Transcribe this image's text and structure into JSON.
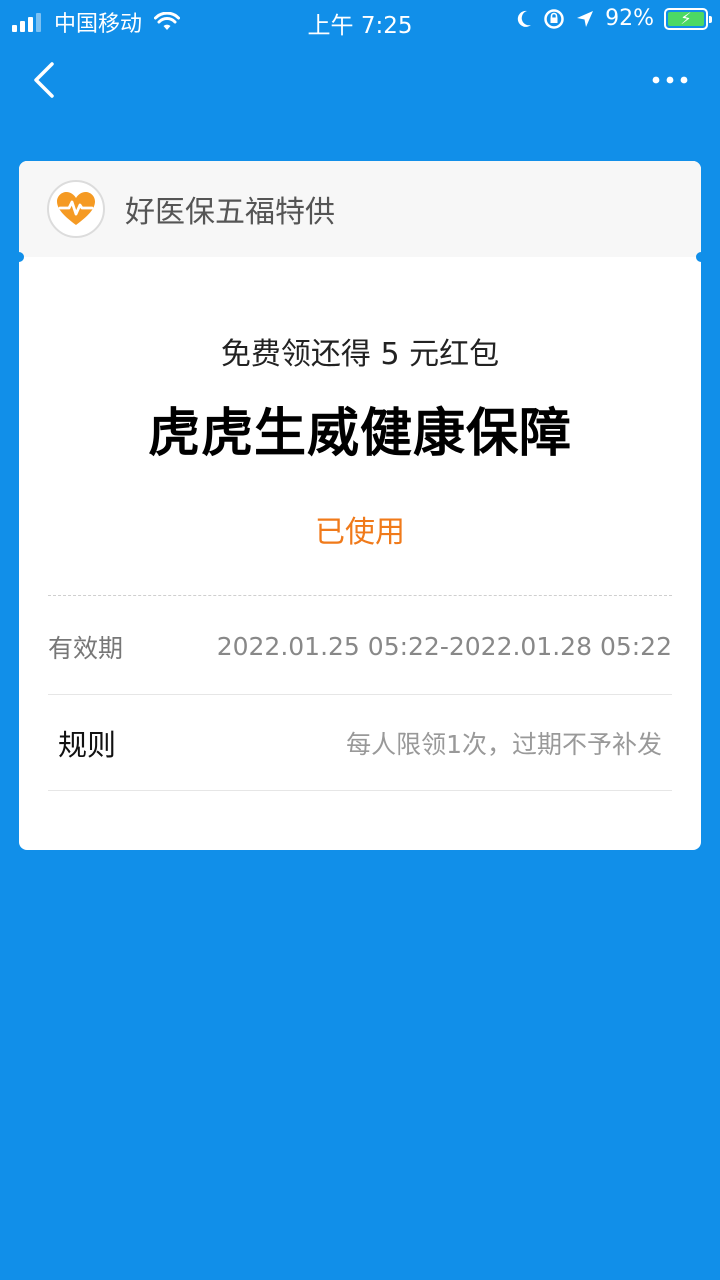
{
  "status_bar": {
    "carrier": "中国移动",
    "time": "上午 7:25",
    "battery": "92%"
  },
  "nav": {
    "back_icon": "chevron-left-icon",
    "more_icon": "more-dots-icon"
  },
  "card": {
    "header_title": "好医保五福特供",
    "logo_icon": "heart-pulse-icon",
    "subtitle": "免费领还得 5 元红包",
    "title": "虎虎生威健康保障",
    "status": "已使用",
    "validity_label": "有效期",
    "validity_value": "2022.01.25 05:22-2022.01.28 05:22",
    "rules_label": "规则",
    "rules_value": "每人限领1次，过期不予补发"
  },
  "colors": {
    "background": "#118fe9",
    "status": "#f07a1a",
    "logo": "#f59a23"
  }
}
